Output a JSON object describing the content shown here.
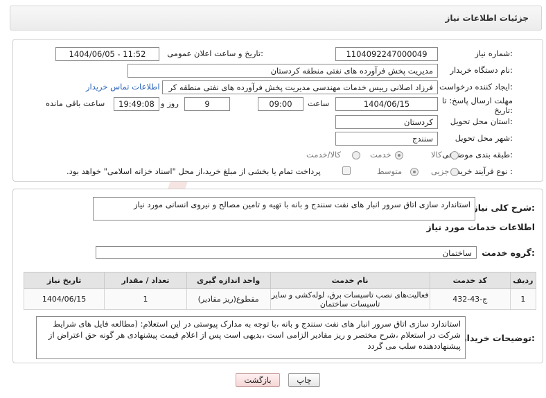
{
  "header": {
    "title": "جزئیات اطلاعات نیاز"
  },
  "fields": {
    "need_number_label": "شماره نیاز:",
    "need_number": "1104092247000049",
    "announce_label": "تاریخ و ساعت اعلان عمومی:",
    "announce_value": "1404/06/05 - 11:52",
    "buyer_org_label": "نام دستگاه خریدار:",
    "buyer_org": "مدیریت پخش فرآورده های نفتی منطقه کردستان",
    "creator_label": "ایجاد کننده درخواست:",
    "creator": "فرزاد اصلانی رییس خدمات مهندسی مدیریت پخش فرآورده های نفتی منطقه کر",
    "contact_link": "اطلاعات تماس خریدار",
    "deadline_label_1": "مهلت ارسال پاسخ: تا",
    "deadline_label_2": "تاریخ:",
    "deadline_date": "1404/06/15",
    "time_label": "ساعت",
    "deadline_time": "09:00",
    "days_value": "9",
    "days_label": "روز و",
    "remaining_time": "19:49:08",
    "remaining_label": "ساعت باقی مانده",
    "province_label": "استان محل تحویل:",
    "province": "کردستان",
    "city_label": "شهر محل تحویل:",
    "city": "سنندج",
    "category_label": "طبقه بندی موضوعی:",
    "category_options": [
      "کالا",
      "خدمت",
      "کالا/خدمت"
    ],
    "category_selected": "خدمت",
    "process_label": "نوع فرآیند خرید :",
    "process_options": [
      "جزیی",
      "متوسط"
    ],
    "process_selected": "متوسط",
    "payment_note": "پرداخت تمام یا بخشی از مبلغ خرید،از محل \"اسناد خزانه اسلامی\" خواهد بود."
  },
  "summary": {
    "label": "شرح کلی نیاز:",
    "text": "استاندارد سازی اتاق سرور انبار های نفت سنندج و بانه با تهیه و تامین مصالح و نیروی انسانی مورد نیاز"
  },
  "services": {
    "section_title": "اطلاعات خدمات مورد نیاز",
    "group_label": "گروه خدمت:",
    "group_value": "ساختمان",
    "columns": [
      "ردیف",
      "کد خدمت",
      "نام خدمت",
      "واحد اندازه گیری",
      "تعداد / مقدار",
      "تاریخ نیاز"
    ],
    "rows": [
      {
        "row": "1",
        "code": "ج-43-432",
        "name": "فعالیت‌های نصب تاسیسات برق، لوله‌کشی و سایر تاسیسات ساختمان",
        "unit": "مقطوع(ریز مقادیر)",
        "qty": "1",
        "date": "1404/06/15"
      }
    ]
  },
  "buyer_notes": {
    "label": "توضیحات خریدار:",
    "text": "استاندارد سازی اتاق سرور انبار های نفت سنندج و بانه ،با توجه به مدارک پیوستی در این استعلام: (مطالعه فایل های شرایط شرکت در استعلام ،شرح مختصر و ریز مقادیر  الزامی است ،بدیهی است پس از اعلام قیمت پیشنهادی هر گونه حق اعتراض از پیشنهاددهنده سلب می گردد"
  },
  "buttons": {
    "print": "چاپ",
    "back": "بازگشت"
  },
  "watermark_text": "AriaTender.net"
}
